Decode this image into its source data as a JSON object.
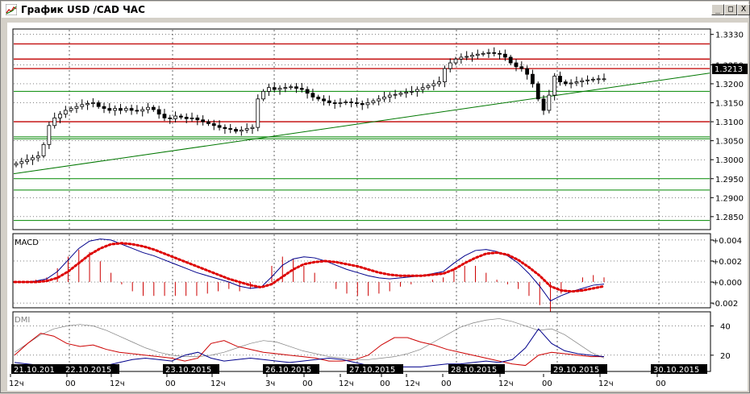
{
  "window": {
    "title": "График USD /CAD  ЧАС",
    "buttons": {
      "minimize": "_",
      "maximize": "□",
      "close": "X"
    }
  },
  "chart_data": [
    {
      "type": "candlestick",
      "title": "",
      "price_ticks": [
        "1.3330",
        "1.3250",
        "1.3200",
        "1.3150",
        "1.3100",
        "1.3050",
        "1.3000",
        "1.2950",
        "1.2900",
        "1.2850"
      ],
      "price_tick_values": [
        1.333,
        1.325,
        1.32,
        1.315,
        1.31,
        1.305,
        1.3,
        1.295,
        1.29,
        1.285
      ],
      "ylim": [
        1.282,
        1.334
      ],
      "current_price": "1.3213",
      "red_levels": [
        1.3305,
        1.3265,
        1.324,
        1.31
      ],
      "green_levels": [
        1.318,
        1.306,
        1.3055,
        1.295,
        1.292,
        1.284
      ],
      "trendline": {
        "start": 1.2963,
        "end": 1.3228
      },
      "closes": [
        1.299,
        1.2995,
        1.3,
        1.3005,
        1.301,
        1.304,
        1.309,
        1.311,
        1.312,
        1.313,
        1.3135,
        1.314,
        1.3145,
        1.3148,
        1.315,
        1.314,
        1.3135,
        1.313,
        1.3135,
        1.313,
        1.3135,
        1.313,
        1.3128,
        1.3132,
        1.3138,
        1.3132,
        1.312,
        1.311,
        1.3108,
        1.3115,
        1.3112,
        1.3108,
        1.311,
        1.3105,
        1.31,
        1.3095,
        1.309,
        1.3085,
        1.3082,
        1.308,
        1.3075,
        1.3078,
        1.3082,
        1.3085,
        1.316,
        1.318,
        1.319,
        1.3185,
        1.3188,
        1.319,
        1.3192,
        1.3188,
        1.3185,
        1.3175,
        1.3165,
        1.316,
        1.3155,
        1.315,
        1.3148,
        1.315,
        1.3152,
        1.315,
        1.3148,
        1.3145,
        1.315,
        1.3155,
        1.316,
        1.3165,
        1.317,
        1.3172,
        1.3175,
        1.3178,
        1.318,
        1.3185,
        1.319,
        1.3195,
        1.32,
        1.3205,
        1.324,
        1.3255,
        1.3265,
        1.327,
        1.3272,
        1.3275,
        1.3278,
        1.328,
        1.3282,
        1.328,
        1.3278,
        1.327,
        1.3255,
        1.3245,
        1.324,
        1.3225,
        1.32,
        1.316,
        1.313,
        1.317,
        1.322,
        1.3205,
        1.32,
        1.3202,
        1.3205,
        1.3208,
        1.321,
        1.3212,
        1.3213,
        1.3213
      ],
      "x_date_labels": [
        "21.10.201",
        "22.10.2015",
        "23.10.2015",
        "26.10.2015",
        "27.10.2015",
        "28.10.2015",
        "29.10.2015",
        "30.10.2015"
      ],
      "x_hour_labels": [
        "12ч",
        "00",
        "12ч",
        "00",
        "12ч",
        "3ч",
        "00",
        "12ч",
        "00",
        "12ч",
        "00",
        "12ч",
        "00",
        "12ч",
        "00"
      ]
    },
    {
      "type": "line",
      "title": "MACD",
      "ticks": [
        "+0.004",
        "+0.002",
        "+0.000",
        "-0.002"
      ],
      "tick_values": [
        0.004,
        0.002,
        0.0,
        -0.002
      ],
      "ylim": [
        -0.0023,
        0.0043
      ],
      "series": [
        {
          "name": "",
          "color": "#00008b",
          "values": [
            0.0,
            0.0,
            0.0001,
            0.0003,
            0.001,
            0.0021,
            0.0032,
            0.0039,
            0.0041,
            0.004,
            0.0036,
            0.0032,
            0.0028,
            0.0025,
            0.0021,
            0.0017,
            0.0013,
            0.0009,
            0.0006,
            0.0003,
            0.0,
            -0.0004,
            -0.0006,
            -0.0005,
            0.0005,
            0.0016,
            0.0022,
            0.0024,
            0.0023,
            0.002,
            0.0016,
            0.0012,
            0.0009,
            0.0006,
            0.0004,
            0.0003,
            0.0004,
            0.0005,
            0.0006,
            0.0008,
            0.001,
            0.0018,
            0.0025,
            0.003,
            0.0031,
            0.0029,
            0.0025,
            0.0018,
            0.0008,
            -0.0004,
            -0.0018,
            -0.0013,
            -0.0009,
            -0.0006,
            -0.0003,
            -0.0002
          ]
        },
        {
          "name": "",
          "color": "#dd0000",
          "values": [
            0.0,
            0.0,
            0.0,
            0.0001,
            0.0004,
            0.001,
            0.0018,
            0.0026,
            0.0032,
            0.0036,
            0.0037,
            0.0036,
            0.0034,
            0.0031,
            0.0027,
            0.0023,
            0.0019,
            0.0015,
            0.0011,
            0.0007,
            0.0003,
            0.0,
            -0.0003,
            -0.0005,
            -0.0002,
            0.0005,
            0.0012,
            0.0017,
            0.0019,
            0.002,
            0.0019,
            0.0017,
            0.0015,
            0.0012,
            0.0009,
            0.0007,
            0.0006,
            0.0006,
            0.0006,
            0.0007,
            0.0008,
            0.0012,
            0.0018,
            0.0023,
            0.0027,
            0.0028,
            0.0026,
            0.0021,
            0.0014,
            0.0006,
            -0.0004,
            -0.0008,
            -0.0009,
            -0.0008,
            -0.0006,
            -0.0004
          ]
        }
      ]
    },
    {
      "type": "line",
      "title": "DMI",
      "ticks": [
        "40",
        "20"
      ],
      "tick_values": [
        40,
        20
      ],
      "ylim": [
        10,
        48
      ],
      "series": [
        {
          "name": "",
          "color": "#808080",
          "values": [
            22,
            28,
            34,
            38,
            40,
            41,
            40,
            37,
            33,
            29,
            25,
            22,
            20,
            19,
            19,
            20,
            22,
            25,
            28,
            30,
            29,
            26,
            23,
            21,
            19,
            18,
            17,
            17,
            18,
            19,
            21,
            24,
            29,
            34,
            39,
            42,
            44,
            45,
            43,
            40,
            37,
            38,
            34,
            28,
            22,
            18
          ]
        },
        {
          "name": "",
          "color": "#cc0000",
          "values": [
            20,
            28,
            35,
            33,
            28,
            26,
            27,
            24,
            22,
            21,
            20,
            19,
            18,
            16,
            18,
            28,
            30,
            26,
            24,
            22,
            21,
            20,
            19,
            18,
            16,
            16,
            17,
            20,
            27,
            32,
            32,
            29,
            27,
            24,
            22,
            20,
            18,
            16,
            14,
            13,
            20,
            22,
            21,
            20,
            19,
            19
          ]
        },
        {
          "name": "",
          "color": "#00008b",
          "values": [
            15,
            14,
            13,
            13,
            12,
            12,
            12,
            13,
            15,
            17,
            18,
            17,
            16,
            20,
            22,
            18,
            16,
            17,
            18,
            17,
            16,
            15,
            16,
            17,
            18,
            17,
            15,
            13,
            12,
            12,
            12,
            12,
            13,
            14,
            14,
            15,
            16,
            15,
            17,
            25,
            38,
            28,
            23,
            21,
            20,
            19
          ]
        }
      ]
    }
  ]
}
